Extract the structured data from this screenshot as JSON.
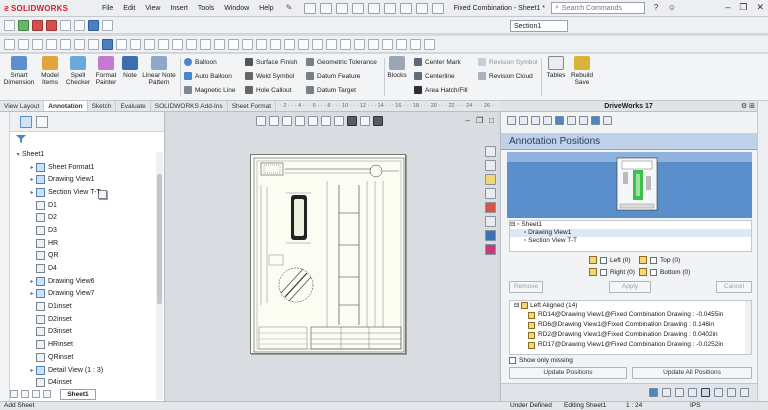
{
  "app": {
    "logo": "SOLIDWORKS",
    "document_title": "Fixed Combination - Sheet1 *"
  },
  "menu": [
    "File",
    "Edit",
    "View",
    "Insert",
    "Tools",
    "Window",
    "Help"
  ],
  "search": {
    "placeholder": "Search Commands"
  },
  "section_select": "Section1",
  "ribbon": {
    "smart_dimension": "Smart Dimension",
    "model_items": "Model Items",
    "spell_checker": "Spell Checker",
    "format_painter": "Format Painter",
    "note": "Note",
    "linear_note_pattern": "Linear Note Pattern",
    "balloon": "Balloon",
    "auto_balloon": "Auto Balloon",
    "magnetic_line": "Magnetic Line",
    "surface_finish": "Surface Finish",
    "weld_symbol": "Weld Symbol",
    "hole_callout": "Hole Callout",
    "geometric_tolerance": "Geometric Tolerance",
    "datum_feature": "Datum Feature",
    "datum_target": "Datum Target",
    "blocks": "Blocks",
    "center_mark": "Center Mark",
    "centerline": "Centerline",
    "area_hatch": "Area Hatch/Fill",
    "revision_symbol": "Revision Symbol",
    "revision_cloud": "Revision Cloud",
    "tables": "Tables",
    "rebuild": "Rebuild",
    "save": "Save"
  },
  "tabs": [
    "View Layout",
    "Annotation",
    "Sketch",
    "Evaluate",
    "SOLIDWORKS Add-Ins",
    "Sheet Format"
  ],
  "ruler_text": "· 2 · · · 4 · · · 6 · · · 8 · · · 10 · · · 12 · · · 14 · · · 16 · · · 18 · · · 20 · · · 22 · · · 24 · · · 26 · ·",
  "tree": [
    {
      "label": "Sheet1",
      "type": "sheet",
      "indent": 0,
      "exp": "▾"
    },
    {
      "label": "Sheet Format1",
      "type": "dv",
      "indent": 1,
      "exp": "▸"
    },
    {
      "label": "Drawing View1",
      "type": "dv",
      "indent": 1,
      "exp": "▸"
    },
    {
      "label": "Section View T-T",
      "type": "dv",
      "indent": 1,
      "exp": "▸"
    },
    {
      "label": "D1",
      "type": "item",
      "indent": 1,
      "exp": ""
    },
    {
      "label": "D2",
      "type": "item",
      "indent": 1,
      "exp": ""
    },
    {
      "label": "D3",
      "type": "item",
      "indent": 1,
      "exp": ""
    },
    {
      "label": "HR",
      "type": "item",
      "indent": 1,
      "exp": ""
    },
    {
      "label": "QR",
      "type": "item",
      "indent": 1,
      "exp": ""
    },
    {
      "label": "D4",
      "type": "item",
      "indent": 1,
      "exp": ""
    },
    {
      "label": "Drawing View6",
      "type": "dv",
      "indent": 1,
      "exp": "▸"
    },
    {
      "label": "Drawing View7",
      "type": "dv",
      "indent": 1,
      "exp": "▸"
    },
    {
      "label": "D1inset",
      "type": "item",
      "indent": 1,
      "exp": ""
    },
    {
      "label": "D2inset",
      "type": "item",
      "indent": 1,
      "exp": ""
    },
    {
      "label": "D3inset",
      "type": "item",
      "indent": 1,
      "exp": ""
    },
    {
      "label": "HRinset",
      "type": "item",
      "indent": 1,
      "exp": ""
    },
    {
      "label": "QRinset",
      "type": "item",
      "indent": 1,
      "exp": ""
    },
    {
      "label": "Detail View  (1 : 3)",
      "type": "dv",
      "indent": 1,
      "exp": "▸"
    },
    {
      "label": "D4inset",
      "type": "item",
      "indent": 1,
      "exp": ""
    }
  ],
  "task_pane": {
    "header": "DriveWorks 17",
    "title": "Annotation Positions",
    "tree": [
      "Sheet1",
      "Drawing View1",
      "Section View T-T"
    ],
    "checks": {
      "left": "Left (0)",
      "right": "Right (0)",
      "top": "Top (0)",
      "bottom": "Bottom (0)"
    },
    "remove": "Remove",
    "apply": "Apply",
    "cancel": "Cancel",
    "group": "Left Aligned (14)",
    "results": [
      "RD14@Drawing View1@Fixed Combination Drawing : -0.0455in",
      "RD6@Drawing View1@Fixed Combination Drawing : 0.146in",
      "RD2@Drawing View1@Fixed Combination Drawing : 0.0402in",
      "RD17@Drawing View1@Fixed Combination Drawing : -0.0252in"
    ],
    "show_missing": "Show only missing",
    "update_positions": "Update Positions",
    "update_all_positions": "Update All Positions"
  },
  "sheet_tab": "Sheet1",
  "status": {
    "left": "Add Sheet",
    "state": "Under Defined",
    "editing": "Editing Sheet1",
    "scale": "1 : 24",
    "units": "IPS"
  },
  "colors": {
    "brand_red": "#d6202b",
    "pane_header": "#bfd1e6",
    "preview_blue": "#5b8fcb",
    "sheet_paper": "#fbfcf2"
  }
}
